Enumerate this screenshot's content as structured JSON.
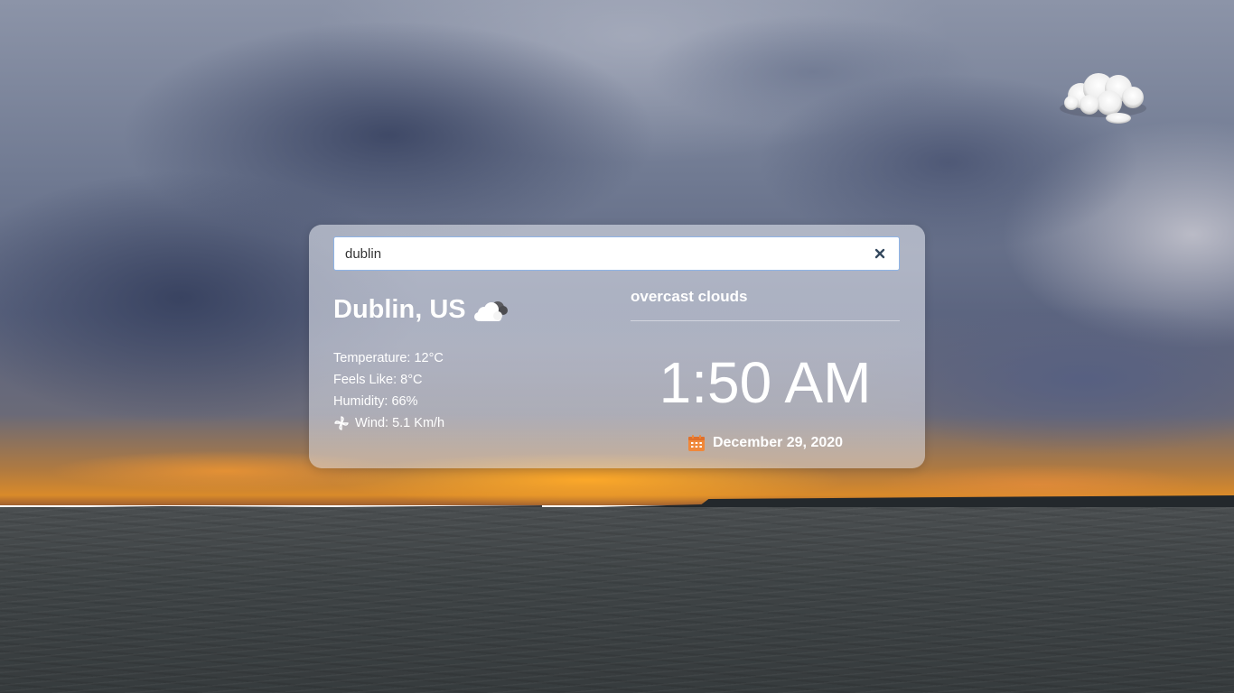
{
  "search": {
    "value": "dublin",
    "clear_icon": "close-icon"
  },
  "location": {
    "city": "Dublin, US",
    "icon": "cloud-icon"
  },
  "conditions": {
    "temperature": "Temperature: 12°C",
    "feels_like": "Feels Like: 8°C",
    "humidity": "Humidity: 66%",
    "wind": "Wind: 5.1 Km/h",
    "wind_icon": "wind-fan-icon",
    "description": "overcast clouds"
  },
  "clock": {
    "time": "1:50 AM",
    "date": "December 29, 2020",
    "date_icon": "calendar-icon"
  },
  "corner_icon": "cloud-icon",
  "colors": {
    "accent_border": "#8fb4e6",
    "calendar": "#f0883a",
    "text": "#ffffff"
  }
}
